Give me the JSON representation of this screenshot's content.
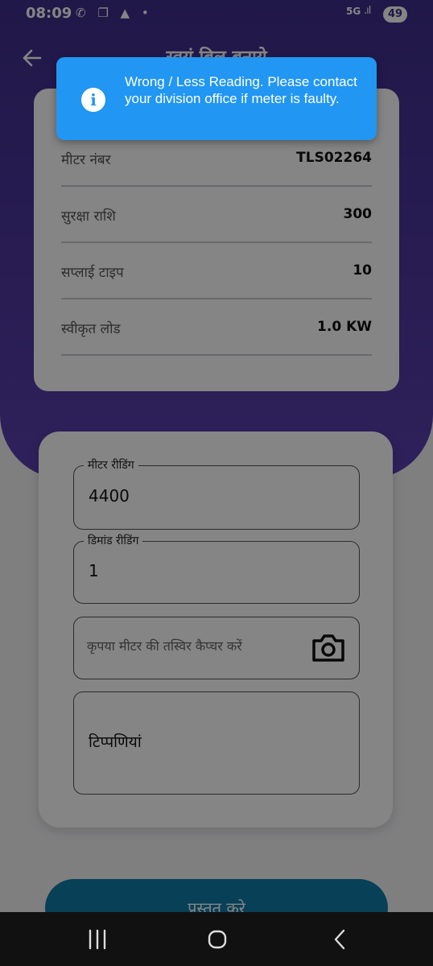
{
  "status_bar": {
    "time": "08:09",
    "notification_icons": "✆ ❐ ▲ •",
    "network": "5G",
    "signal": ".ıl",
    "battery": "49"
  },
  "header": {
    "title": "स्वयं बिल बनाये"
  },
  "info_rows": [
    {
      "label": "मीटर नंबर",
      "value": "TLS02264"
    },
    {
      "label": "सुरक्षा राशि",
      "value": "300"
    },
    {
      "label": "सप्लाई टाइप",
      "value": "10"
    },
    {
      "label": "स्वीकृत लोड",
      "value": "1.0 KW"
    }
  ],
  "form": {
    "meter_reading": {
      "label": "मीटर रीडिंग",
      "value": "4400"
    },
    "demand_reading": {
      "label": "डिमांड रीडिंग",
      "value": "1"
    },
    "photo_placeholder": "कृपया मीटर की तस्विर कैप्चर करें",
    "remarks_placeholder": "टिप्पणियां"
  },
  "submit_label": "प्रस्तुत करे",
  "toast": {
    "message": "Wrong / Less Reading. Please contact your division office if meter is faulty.",
    "icon": "info-icon",
    "color": "#2196f3"
  },
  "colors": {
    "header": "#4a3599",
    "button": "#0e7ba8"
  }
}
